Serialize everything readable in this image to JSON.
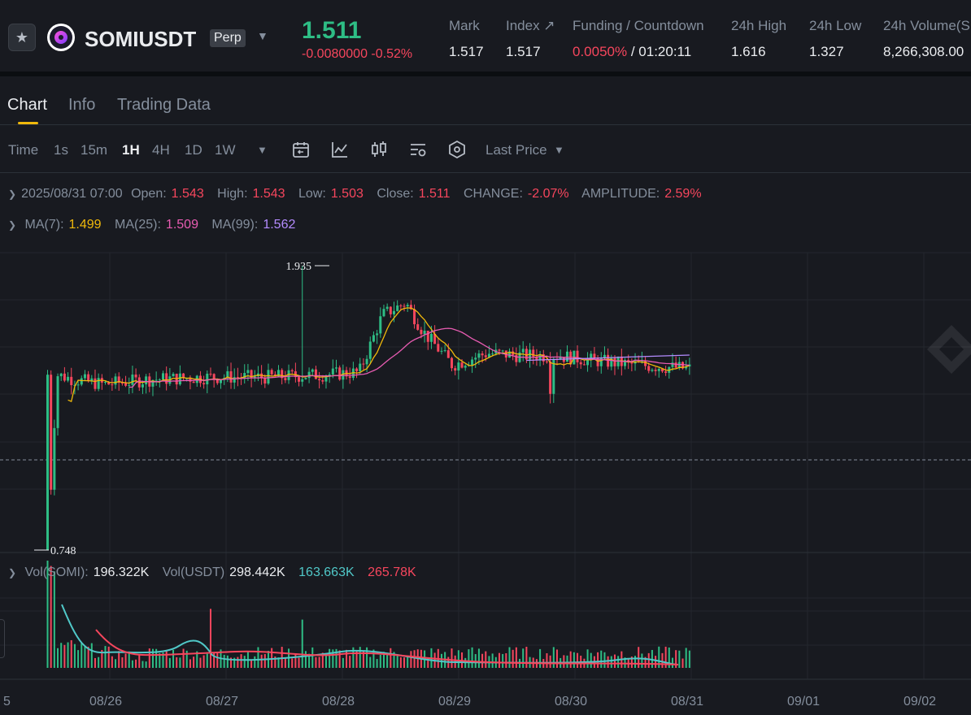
{
  "header": {
    "symbol": "SOMIUSDT",
    "contract_type": "Perp",
    "last_price": "1.511",
    "change": "-0.0080000 -0.52%",
    "stats": [
      {
        "label": "Mark",
        "value": "1.517"
      },
      {
        "label": "Index ↗",
        "value": "1.517"
      },
      {
        "label": "Funding / Countdown",
        "value_rate": "0.0050%",
        "value_time": " / 01:20:11"
      },
      {
        "label": "24h High",
        "value": "1.616"
      },
      {
        "label": "24h Low",
        "value": "1.327"
      },
      {
        "label": "24h Volume(S",
        "value": "8,266,308.00"
      }
    ]
  },
  "tabs": [
    "Chart",
    "Info",
    "Trading Data"
  ],
  "toolbar": {
    "intervals": [
      "Time",
      "1s",
      "15m",
      "1H",
      "4H",
      "1D",
      "1W"
    ],
    "active_interval": "1H",
    "price_type": "Last Price",
    "icons": [
      "calendar-icon",
      "indicator-icon",
      "candle-type-icon",
      "settings-icon",
      "hexagon-icon"
    ]
  },
  "ohlc": {
    "datetime": "2025/08/31 07:00",
    "open_label": "Open:",
    "open": "1.543",
    "high_label": "High:",
    "high": "1.543",
    "low_label": "Low:",
    "low": "1.503",
    "close_label": "Close:",
    "close": "1.511",
    "change_label": "CHANGE:",
    "change": "-2.07%",
    "amplitude_label": "AMPLITUDE:",
    "amplitude": "2.59%"
  },
  "ma": {
    "ma7_label": "MA(7):",
    "ma7": "1.499",
    "ma25_label": "MA(25):",
    "ma25": "1.509",
    "ma99_label": "MA(99):",
    "ma99": "1.562"
  },
  "volume": {
    "somi_label": "Vol(SOMI):",
    "somi": "196.322K",
    "usdt_label": "Vol(USDT)",
    "usdt": "298.442K",
    "ma1": "163.663K",
    "ma2": "265.78K"
  },
  "chart_data": {
    "type": "candlestick",
    "interval": "1H",
    "x_ticks": [
      "5",
      "08/26",
      "08/27",
      "08/28",
      "08/29",
      "08/30",
      "08/31",
      "09/01",
      "09/02"
    ],
    "annotations": {
      "max": "1.935",
      "min": "0.748"
    },
    "candle_count": 190,
    "anchors_days": [
      0.12,
      0.2,
      0.35,
      0.6,
      1.0,
      1.5,
      2.0,
      2.5,
      2.8,
      3.0,
      3.2,
      3.35,
      3.6,
      3.9,
      4.2,
      4.5,
      4.8,
      5.2,
      5.5,
      5.8,
      6.0
    ],
    "anchors_close": [
      0.748,
      1.48,
      1.46,
      1.44,
      1.46,
      1.47,
      1.47,
      1.48,
      1.49,
      1.73,
      1.78,
      1.66,
      1.52,
      1.57,
      1.56,
      1.56,
      1.54,
      1.52,
      1.51,
      1.5,
      1.511
    ],
    "ma99_start": 1.54,
    "ma99_end": 1.562,
    "volume_series_usdt": [],
    "colors": {
      "up": "#2ebd85",
      "down": "#f6465d",
      "ma7": "#f0b90b",
      "ma25": "#e85cb2",
      "ma99": "#b48cff",
      "vol_ma1": "#50c8c8",
      "vol_ma2": "#f6465d"
    }
  }
}
